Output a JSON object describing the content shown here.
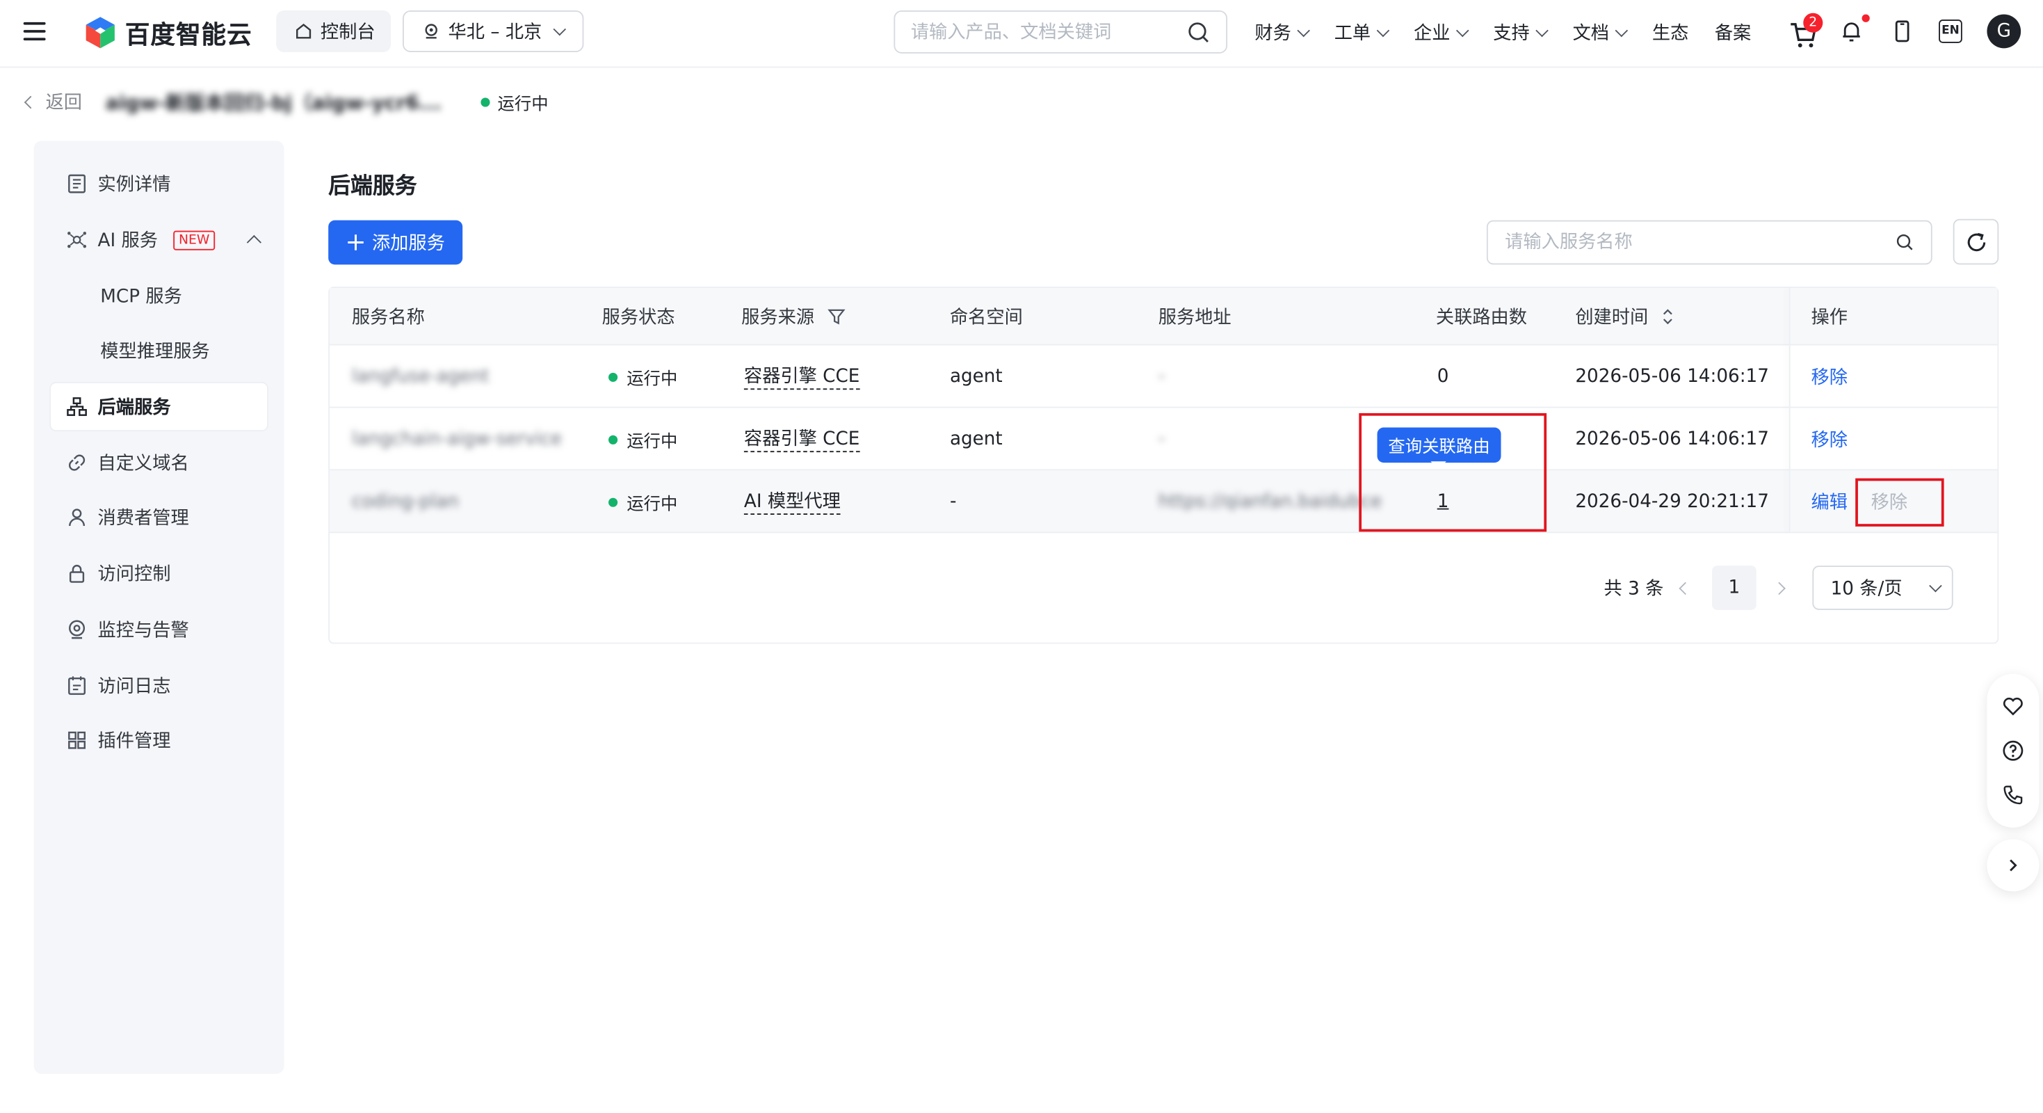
{
  "header": {
    "brand": "百度智能云",
    "console_label": "控制台",
    "region_label": "华北 – 北京",
    "search_placeholder": "请输入产品、文档关键词",
    "nav": [
      {
        "label": "财务",
        "caret": true
      },
      {
        "label": "工单",
        "caret": true
      },
      {
        "label": "企业",
        "caret": true
      },
      {
        "label": "支持",
        "caret": true
      },
      {
        "label": "文档",
        "caret": true
      },
      {
        "label": "生态",
        "caret": false
      },
      {
        "label": "备案",
        "caret": false
      }
    ],
    "cart_badge": "2",
    "lang_label": "EN",
    "avatar_letter": "G"
  },
  "breadcrumb": {
    "back_label": "返回",
    "instance_name": "aigw-新版本回归-bj（aigw-ycr6...",
    "status": "运行中"
  },
  "sidebar": {
    "items": [
      {
        "label": "实例详情",
        "icon": "document-list-icon"
      },
      {
        "label": "AI 服务",
        "icon": "ai-network-icon",
        "tag": "NEW"
      },
      {
        "label": "MCP 服务",
        "sub": true
      },
      {
        "label": "模型推理服务",
        "sub": true
      },
      {
        "label": "后端服务",
        "icon": "sitemap-icon",
        "active": true
      },
      {
        "label": "自定义域名",
        "icon": "link-icon"
      },
      {
        "label": "消费者管理",
        "icon": "user-icon"
      },
      {
        "label": "访问控制",
        "icon": "lock-icon"
      },
      {
        "label": "监控与告警",
        "icon": "monitor-icon"
      },
      {
        "label": "访问日志",
        "icon": "log-icon"
      },
      {
        "label": "插件管理",
        "icon": "grid-icon"
      }
    ]
  },
  "main": {
    "title": "后端服务",
    "add_button": "添加服务",
    "search_placeholder": "请输入服务名称",
    "table": {
      "columns": [
        "服务名称",
        "服务状态",
        "服务来源",
        "命名空间",
        "服务地址",
        "关联路由数",
        "创建时间",
        "操作"
      ],
      "rows": [
        {
          "name": "langfuse-agent",
          "status": "运行中",
          "source": "容器引擎 CCE",
          "namespace": "agent",
          "address": "-",
          "routes": "0",
          "created": "2026-05-06 14:06:17",
          "ops": [
            "移除"
          ]
        },
        {
          "name": "langchain-aigw-service",
          "status": "运行中",
          "source": "容器引擎 CCE",
          "namespace": "agent",
          "address": "-",
          "routes": "",
          "created": "2026-05-06 14:06:17",
          "ops": [
            "移除"
          ]
        },
        {
          "name": "coding-plan",
          "status": "运行中",
          "source": "AI 模型代理",
          "namespace": "-",
          "address": "https://qianfan.baidubce....",
          "routes": "1",
          "created": "2026-04-29 20:21:17",
          "ops": [
            "编辑",
            "移除"
          ]
        }
      ]
    },
    "tooltip": "查询关联路由",
    "pagination": {
      "total": "共 3 条",
      "current": "1",
      "page_size": "10 条/页"
    }
  },
  "colors": {
    "primary": "#2468f2",
    "success": "#13b36b",
    "annotation_red": "#e3141e"
  }
}
